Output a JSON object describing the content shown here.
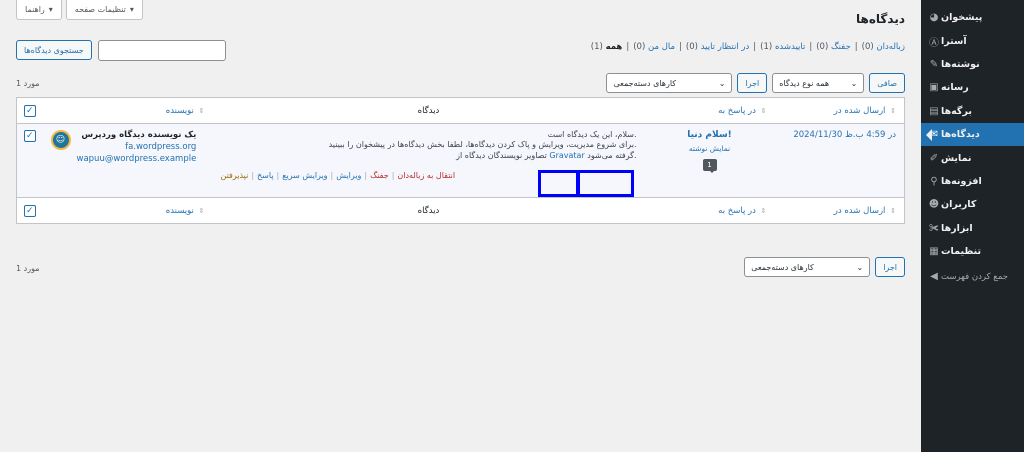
{
  "sidebar": {
    "items": [
      {
        "label": "پیشخوان",
        "icon": "dashboard-icon",
        "glyph": "◕"
      },
      {
        "label": "آسترا",
        "icon": "astra-icon",
        "glyph": "Ⓐ"
      },
      {
        "label": "نوشته‌ها",
        "icon": "pin-icon",
        "glyph": "✎"
      },
      {
        "label": "رسانه",
        "icon": "media-icon",
        "glyph": "▣"
      },
      {
        "label": "برگه‌ها",
        "icon": "pages-icon",
        "glyph": "▤"
      },
      {
        "label": "دیدگاه‌ها",
        "icon": "comments-icon",
        "glyph": "✉",
        "current": true
      },
      {
        "label": "نمایش",
        "icon": "appearance-icon",
        "glyph": "✐"
      },
      {
        "label": "افزونه‌ها",
        "icon": "plugins-icon",
        "glyph": "⚲"
      },
      {
        "label": "کاربران",
        "icon": "users-icon",
        "glyph": "☻"
      },
      {
        "label": "ابزارها",
        "icon": "tools-icon",
        "glyph": "✀"
      },
      {
        "label": "تنظیمات",
        "icon": "settings-icon",
        "glyph": "▦"
      }
    ],
    "collapse_label": "جمع کردن فهرست"
  },
  "screen_options": {
    "label": "تنظیمات صفحه",
    "help": "راهنما"
  },
  "page_title": "دیدگاه‌ها",
  "filters": {
    "all": "همه",
    "all_count": "(1)",
    "mine": "مال من",
    "mine_count": "(0)",
    "pending": "در انتظار تایید",
    "pending_count": "(0)",
    "approved": "تاییدشده",
    "approved_count": "(1)",
    "spam": "جفنگ",
    "spam_count": "(0)",
    "trash": "زباله‌دان",
    "trash_count": "(0)"
  },
  "search": {
    "button": "جستجوی دیدگاه‌ها"
  },
  "bulk": {
    "select": "کارهای دسته‌جمعی",
    "apply": "اجرا",
    "type_filter": "همه نوع دیدگاه",
    "filter_button": "صافی"
  },
  "item_count": "1 مورد",
  "columns": {
    "author": "نویسنده",
    "comment": "دیدگاه",
    "response": "در پاسخ به",
    "date": "ارسال شده در"
  },
  "comment": {
    "author_name": "یک نویسنده دیدگاه وردپرس",
    "author_url": "fa.wordpress.org",
    "author_email": "wapuu@wordpress.example",
    "line1": "سلام، این یک دیدگاه است.",
    "line2": "برای شروع مدیریت، ویرایش و پاک کردن دیدگاه‌ها، لطفا بخش دیدگاه‌ها در پیشخوان را ببینید.",
    "line3_prefix": "تصاویر نویسندگان دیدگاه از",
    "line3_link": "Gravatar",
    "line3_suffix": "گرفته می‌شود.",
    "actions": {
      "unapprove": "نپذیرفتن",
      "reply": "پاسخ",
      "quick_edit": "ویرایش سریع",
      "edit": "ویرایش",
      "spam": "جفنگ",
      "trash": "انتقال به زباله‌دان"
    },
    "response_title": "سلام دنیا!",
    "response_view": "نمایش نوشته",
    "response_count": "1",
    "date": "2024/11/30 در 4:59 ب.ظ"
  },
  "highlight_color": "#0000ff"
}
